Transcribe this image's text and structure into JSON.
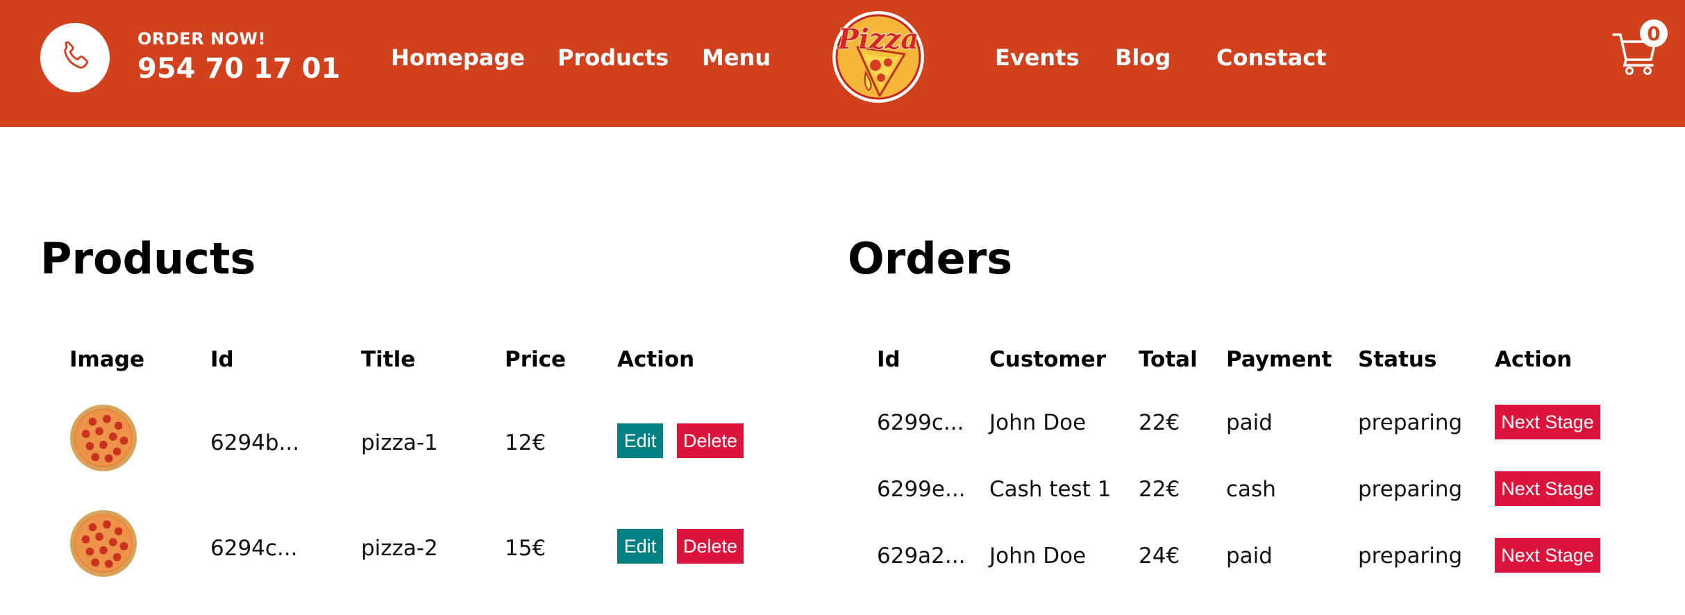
{
  "header": {
    "order_label": "ORDER NOW!",
    "phone_number": "954 70 17 01",
    "nav_left": [
      "Homepage",
      "Products",
      "Menu"
    ],
    "nav_right": [
      "Events",
      "Blog",
      "Constact"
    ],
    "logo_text": "Pizza",
    "cart_count": "0"
  },
  "products": {
    "title": "Products",
    "columns": [
      "Image",
      "Id",
      "Title",
      "Price",
      "Action"
    ],
    "rows": [
      {
        "id": "6294b...",
        "title": "pizza-1",
        "price": "12€"
      },
      {
        "id": "6294c...",
        "title": "pizza-2",
        "price": "15€"
      }
    ],
    "edit_label": "Edit",
    "delete_label": "Delete"
  },
  "orders": {
    "title": "Orders",
    "columns": [
      "Id",
      "Customer",
      "Total",
      "Payment",
      "Status",
      "Action"
    ],
    "rows": [
      {
        "id": "6299c...",
        "customer": "John Doe",
        "total": "22€",
        "payment": "paid",
        "status": "preparing"
      },
      {
        "id": "6299e...",
        "customer": "Cash test 1",
        "total": "22€",
        "payment": "cash",
        "status": "preparing"
      },
      {
        "id": "629a2...",
        "customer": "John Doe",
        "total": "24€",
        "payment": "paid",
        "status": "preparing"
      }
    ],
    "next_stage_label": "Next Stage"
  },
  "colors": {
    "header_bg": "#d1411e",
    "edit_button": "#008080",
    "danger_button": "#dc143c"
  },
  "icons": {
    "phone": "phone-icon",
    "cart": "cart-icon",
    "logo": "pizza-logo"
  }
}
